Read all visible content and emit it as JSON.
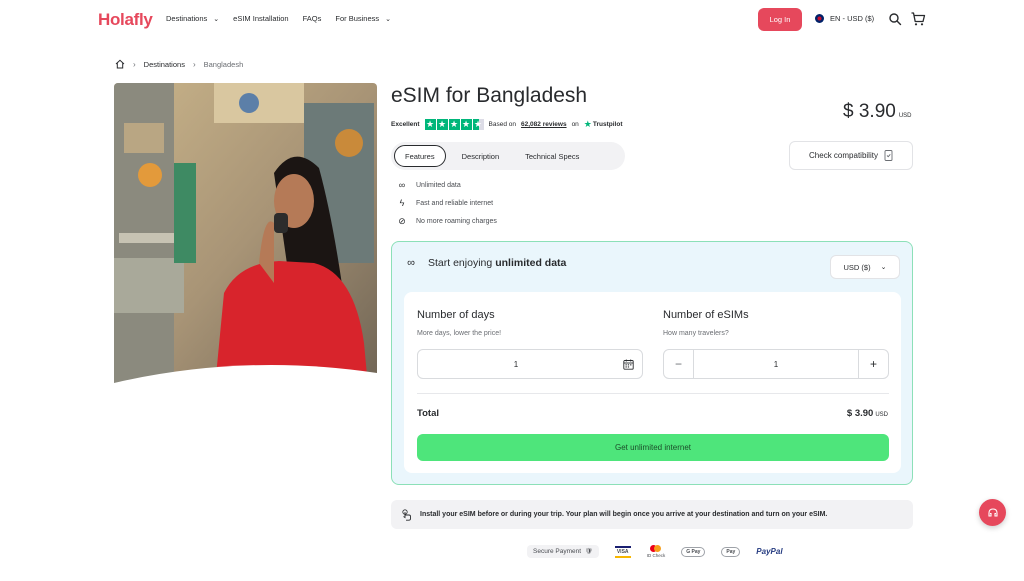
{
  "brand": {
    "logo_text": "Holafly",
    "accent": "#e6485c",
    "cta_color": "#4ee57b"
  },
  "header": {
    "nav": [
      {
        "label": "Destinations",
        "has_dropdown": true
      },
      {
        "label": "eSIM Installation",
        "has_dropdown": false
      },
      {
        "label": "FAQs",
        "has_dropdown": false
      },
      {
        "label": "For Business",
        "has_dropdown": true
      }
    ],
    "login_label": "Log In",
    "language_label": "EN - USD ($)",
    "icons": [
      "search-icon",
      "cart-icon"
    ]
  },
  "breadcrumb": {
    "items": [
      "Destinations",
      "Bangladesh"
    ]
  },
  "product": {
    "title": "eSIM for Bangladesh",
    "price": "$ 3.90",
    "price_unit": "USD",
    "rating": {
      "label": "Excellent",
      "stars": 4.5,
      "based_on": "Based on",
      "reviews": "62,082 reviews",
      "on": "on",
      "platform": "Trustpilot"
    },
    "tabs": [
      {
        "label": "Features",
        "active": true
      },
      {
        "label": "Description",
        "active": false
      },
      {
        "label": "Technical Specs",
        "active": false
      }
    ],
    "check_compatibility": "Check compatibility",
    "features": [
      {
        "icon": "infinity-icon",
        "label": "Unlimited data"
      },
      {
        "icon": "lightning-icon",
        "label": "Fast and reliable internet"
      },
      {
        "icon": "no-roaming-icon",
        "label": "No more roaming charges"
      }
    ]
  },
  "plan": {
    "heading_prefix": "Start enjoying",
    "heading_bold": "unlimited data",
    "currency": "USD ($)",
    "days": {
      "title": "Number of days",
      "subtitle": "More days, lower the price!",
      "value": "1"
    },
    "esims": {
      "title": "Number of eSIMs",
      "subtitle": "How many travelers?",
      "value": "1",
      "minus": "−",
      "plus": "+"
    },
    "total_label": "Total",
    "total_price": "$ 3.90",
    "total_unit": "USD",
    "cta_label": "Get unlimited internet"
  },
  "install_note": "Install your eSIM before or during your trip. Your plan will begin once you arrive at your destination and turn on your eSIM.",
  "payment": {
    "secure_label": "Secure Payment",
    "methods": [
      "VISA",
      "ID Check",
      "G Pay",
      "Pay",
      "PayPal"
    ]
  }
}
